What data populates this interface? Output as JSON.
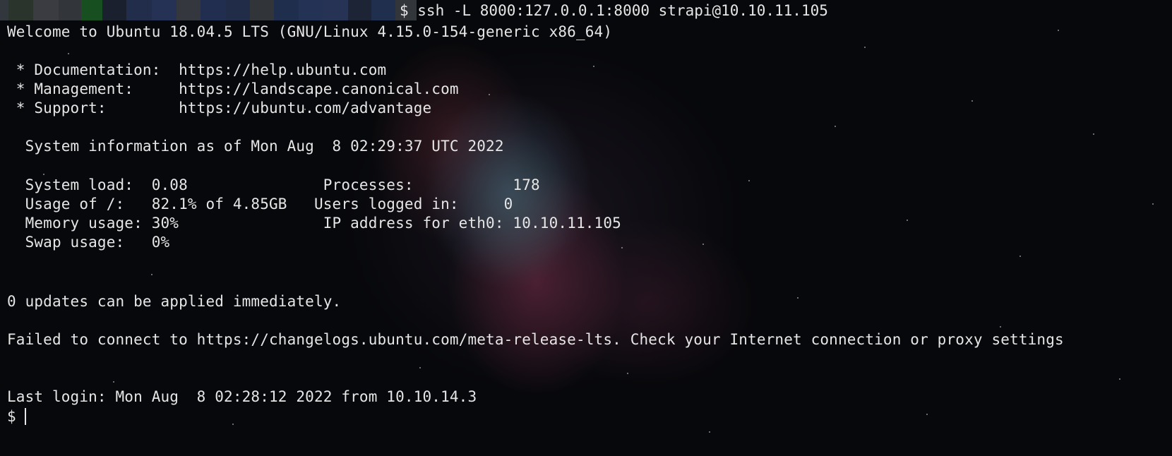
{
  "terminal": {
    "command_line": "$ ssh -L 8000:127.0.0.1:8000 strapi@10.10.11.105",
    "lines": [
      "Welcome to Ubuntu 18.04.5 LTS (GNU/Linux 4.15.0-154-generic x86_64)",
      "",
      " * Documentation:  https://help.ubuntu.com",
      " * Management:     https://landscape.canonical.com",
      " * Support:        https://ubuntu.com/advantage",
      "",
      "  System information as of Mon Aug  8 02:29:37 UTC 2022",
      "",
      "  System load:  0.08               Processes:           178",
      "  Usage of /:   82.1% of 4.85GB   Users logged in:     0",
      "  Memory usage: 30%                IP address for eth0: 10.10.11.105",
      "  Swap usage:   0%",
      "",
      "",
      "0 updates can be applied immediately.",
      "",
      "Failed to connect to https://changelogs.ubuntu.com/meta-release-lts. Check your Internet connection or proxy settings",
      "",
      "",
      "Last login: Mon Aug  8 02:28:12 2022 from 10.10.14.3",
      "$"
    ]
  },
  "colors": {
    "text": "#e6e6e6",
    "background": "#07080b"
  }
}
